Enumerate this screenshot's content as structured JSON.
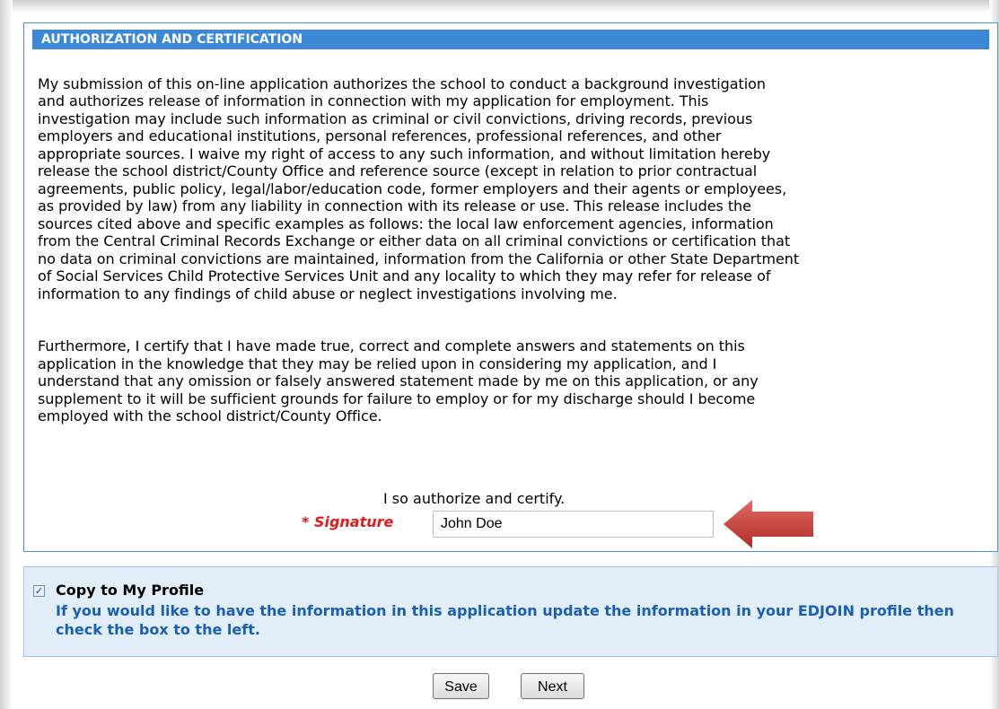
{
  "section": {
    "header": "AUTHORIZATION AND CERTIFICATION",
    "paragraph1": "My submission of this on-line application authorizes the school to conduct a background investigation\nand authorizes release of information in connection with my application for employment. This\ninvestigation may include such information as criminal or civil convictions, driving records, previous\nemployers and educational institutions, personal references, professional references, and other\nappropriate sources. I waive my right of access to any such information, and without limitation hereby\nrelease the school district/County Office and reference source (except in relation to prior contractual\nagreements, public policy, legal/labor/education code, former employers and their agents or employees,\nas provided by law) from any liability in connection with its release or use. This release includes the\nsources cited above and specific examples as follows: the local law enforcement agencies, information\nfrom the Central Criminal Records Exchange or either data on all criminal convictions or certification that\nno data on criminal convictions are maintained, information from the California or other State Department\nof Social Services Child Protective Services Unit and any locality to which they may refer for release of\ninformation to any findings of child abuse or neglect investigations involving me.",
    "paragraph2": "Furthermore, I certify that I have made true, correct and complete answers and statements on this\napplication in the knowledge that they may be relied upon in considering my application, and I\nunderstand that any omission or falsely answered statement made by me on this application, or any\nsupplement to it will be sufficient grounds for failure to employ or for my discharge should I become\nemployed with the school district/County Office.",
    "authorize_line": "I so authorize and certify.",
    "signature_label": "* Signature",
    "signature_value": "John Doe"
  },
  "profile": {
    "checked": true,
    "checkmark": "✓",
    "title": "Copy to My Profile",
    "description": "If you would like to have the information in this application update the information in your EDJOIN profile then check the box to the left."
  },
  "buttons": {
    "save": "Save",
    "next": "Next"
  },
  "colors": {
    "header_bg": "#3b88d6",
    "required_red": "#e31b1b",
    "profile_bg": "#e1eef8",
    "profile_text": "#1a5fb4",
    "arrow": "#c9403a"
  }
}
